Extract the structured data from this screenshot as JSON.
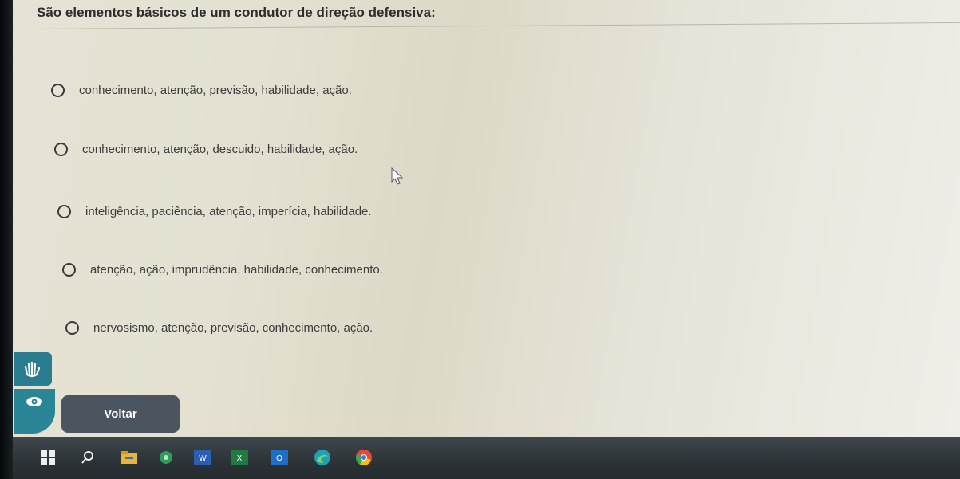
{
  "question": {
    "text": "São elementos básicos de um condutor de direção defensiva:"
  },
  "options": [
    {
      "label": "conhecimento, atenção, previsão, habilidade, ação."
    },
    {
      "label": "conhecimento, atenção, descuido, habilidade, ação."
    },
    {
      "label": "inteligência, paciência, atenção, imperícia, habilidade."
    },
    {
      "label": "atenção, ação, imprudência, habilidade, conhecimento."
    },
    {
      "label": "nervosismo, atenção, previsão, conhecimento, ação."
    }
  ],
  "actions": {
    "back_label": "Voltar"
  },
  "accessibility_widgets": [
    {
      "icon": "sign-language-hand-icon"
    },
    {
      "icon": "eye-icon"
    }
  ],
  "taskbar": {
    "items": [
      {
        "icon": "windows-start-icon"
      },
      {
        "icon": "search-icon"
      },
      {
        "icon": "file-explorer-icon"
      },
      {
        "icon": "app-circle-icon"
      },
      {
        "icon": "word-icon",
        "text": "W"
      },
      {
        "icon": "excel-icon",
        "text": "X"
      },
      {
        "icon": "outlook-icon",
        "text": "O"
      },
      {
        "icon": "edge-icon"
      },
      {
        "icon": "chrome-icon"
      }
    ]
  },
  "colors": {
    "button_bg": "#4a5560",
    "widget_teal": "#2a8596",
    "taskbar_bg": "#2c3337"
  }
}
